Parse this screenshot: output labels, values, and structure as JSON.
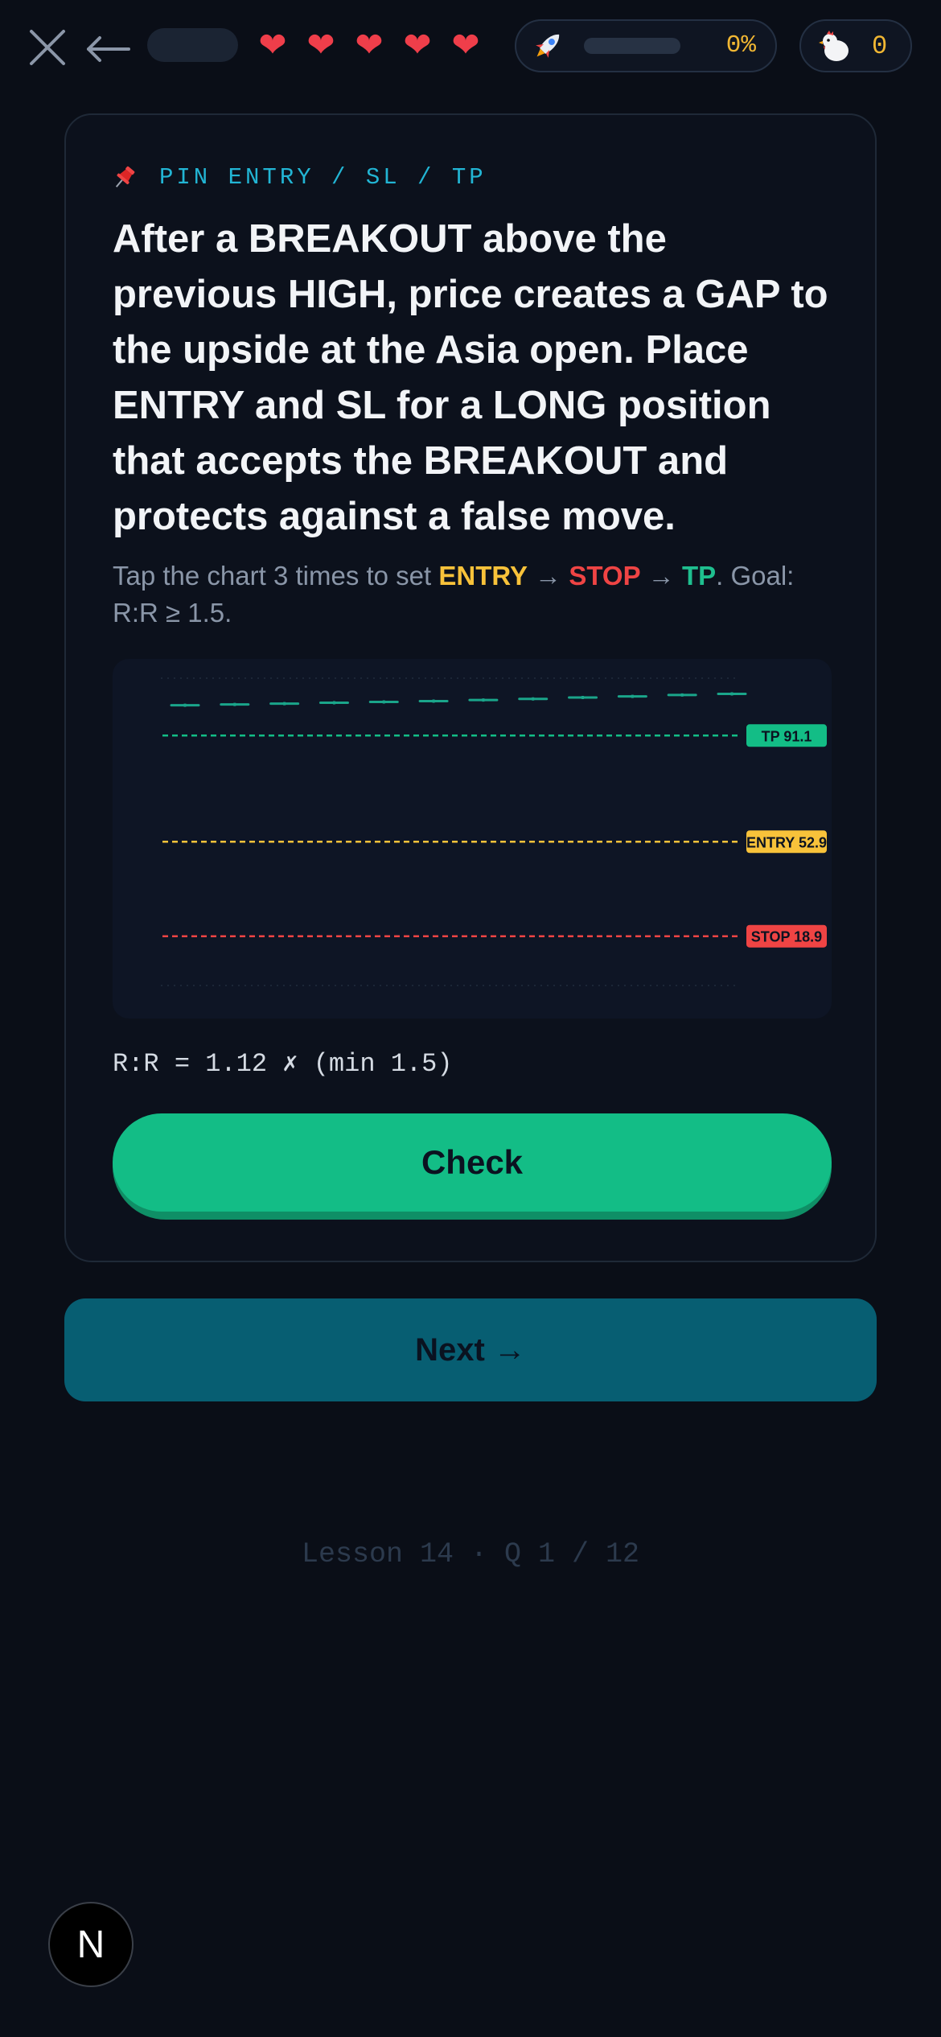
{
  "header": {
    "hearts": [
      "❤",
      "❤",
      "❤",
      "❤",
      "❤"
    ],
    "progress_percent": 0,
    "progress_label": "0%",
    "coins": "0"
  },
  "card": {
    "tag": "PIN ENTRY / SL / TP",
    "question": "After a BREAKOUT above the previous HIGH, price creates a GAP to the upside at the Asia open. Place ENTRY and SL for a LONG position that accepts the BREAKOUT and protects against a false move.",
    "instruction": {
      "prefix": "Tap the chart 3 times to set ",
      "entry": "ENTRY",
      "arrow1": " → ",
      "stop": "STOP",
      "arrow2": " → ",
      "tp": "TP",
      "suffix": ". Goal: R:R ≥ 1.5."
    },
    "rr_text": "R:R = 1.12 ✗ (min 1.5)",
    "check_label": "Check"
  },
  "chart_data": {
    "type": "line",
    "candles_y": [
      102.0,
      102.3,
      102.6,
      102.9,
      103.2,
      103.5,
      103.9,
      104.3,
      104.8,
      105.2,
      105.7,
      106.1
    ],
    "levels": [
      {
        "name": "TP",
        "value": 91.1,
        "label": "TP 91.1",
        "color": "#13bd86"
      },
      {
        "name": "ENTRY",
        "value": 52.9,
        "label": "ENTRY 52.9",
        "color": "#f8c23a"
      },
      {
        "name": "STOP",
        "value": 18.9,
        "label": "STOP 18.9",
        "color": "#ef4444"
      }
    ],
    "candle_color": "#1aa58a",
    "grid": true
  },
  "next_label": "Next →",
  "footer": "Lesson 14 · Q 1 / 12",
  "badge_letter": "N"
}
